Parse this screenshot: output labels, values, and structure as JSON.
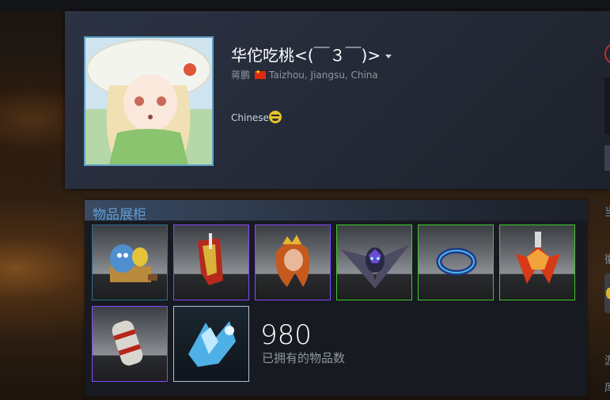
{
  "profile": {
    "persona_name": "华佗吃桃<(￣３￣)>",
    "real_name": "蒋鹏",
    "location": "Taizhou, Jiangsu, China",
    "summary": "Chinese"
  },
  "showcase": {
    "title": "物品展柜",
    "items": [
      {
        "name": "item-courier-trio",
        "rarity": "teal"
      },
      {
        "name": "item-red-armor",
        "rarity": "purple"
      },
      {
        "name": "item-orange-hair",
        "rarity": "purple"
      },
      {
        "name": "item-dark-winged-head",
        "rarity": "green"
      },
      {
        "name": "item-blue-ring",
        "rarity": "green"
      },
      {
        "name": "item-fire-flower",
        "rarity": "green"
      },
      {
        "name": "item-bracer",
        "rarity": "purple"
      },
      {
        "name": "item-ice-hero",
        "rarity": "white"
      }
    ],
    "item_count": "980",
    "item_count_label": "已拥有的物品数"
  },
  "colors": {
    "accent": "#5c9ed6",
    "rarity_purple": "#8847ff",
    "rarity_green": "#3dca2c"
  }
}
